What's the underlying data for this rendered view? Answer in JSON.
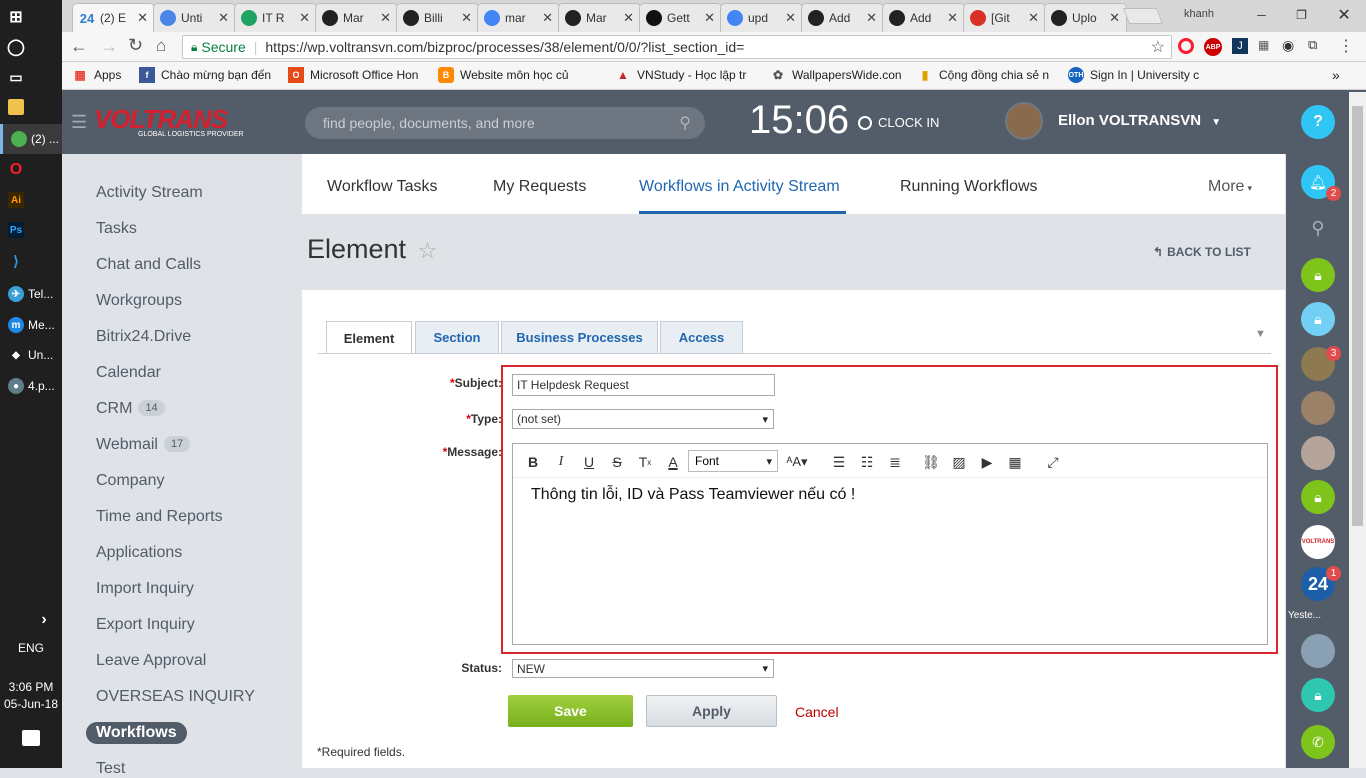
{
  "taskbar": {
    "items": [
      "(2) ...",
      "Tel...",
      "Me...",
      "Un...",
      "4.p..."
    ],
    "lang": "ENG",
    "time": "3:06 PM",
    "date": "05-Jun-18"
  },
  "browser": {
    "tabs": [
      {
        "title": "(2) E",
        "favicon": "24",
        "color": "#2f7dd1"
      },
      {
        "title": "Unti",
        "favicon": "doc-icon",
        "color": "#4a86e8"
      },
      {
        "title": "IT R",
        "favicon": "drive-icon",
        "color": "#1da462"
      },
      {
        "title": "Mar",
        "favicon": "github-icon",
        "color": "#222222"
      },
      {
        "title": "Billi",
        "favicon": "github-icon",
        "color": "#222222"
      },
      {
        "title": "mar",
        "favicon": "google-icon",
        "color": "#4285f4"
      },
      {
        "title": "Mar",
        "favicon": "github-icon",
        "color": "#222222"
      },
      {
        "title": "Gett",
        "favicon": "medium-icon",
        "color": "#111111"
      },
      {
        "title": "upd",
        "favicon": "google-icon",
        "color": "#4285f4"
      },
      {
        "title": "Add",
        "favicon": "github-icon",
        "color": "#222222"
      },
      {
        "title": "Add",
        "favicon": "github-icon",
        "color": "#222222"
      },
      {
        "title": "[Git",
        "favicon": "gmail-icon",
        "color": "#d93025"
      },
      {
        "title": "Uplo",
        "favicon": "github-icon",
        "color": "#222222"
      }
    ],
    "profile": "khanh",
    "secure": "Secure",
    "url": "https://wp.voltransvn.com/bizproc/processes/38/element/0/0/?list_section_id=",
    "bookmarks": [
      "Apps",
      "Chào mừng bạn đến",
      "Microsoft Office Hon",
      "Website môn học củ",
      "VNStudy - Học lập tr",
      "WallpapersWide.con",
      "Cộng đồng chia sẻ n",
      "Sign In | University c"
    ]
  },
  "header": {
    "logo": "VOLTRANS",
    "logo_sub": "GLOBAL LOGISTICS PROVIDER",
    "search_placeholder": "find people, documents, and more",
    "clock": "15:06",
    "clock_in": "CLOCK IN",
    "user": "Ellon VOLTRANSVN"
  },
  "menu": {
    "items": [
      {
        "label": "Activity Stream"
      },
      {
        "label": "Tasks"
      },
      {
        "label": "Chat and Calls"
      },
      {
        "label": "Workgroups"
      },
      {
        "label": "Bitrix24.Drive"
      },
      {
        "label": "Calendar"
      },
      {
        "label": "CRM",
        "count": "14"
      },
      {
        "label": "Webmail",
        "count": "17"
      },
      {
        "label": "Company"
      },
      {
        "label": "Time and Reports"
      },
      {
        "label": "Applications"
      },
      {
        "label": "Import Inquiry"
      },
      {
        "label": "Export Inquiry"
      },
      {
        "label": "Leave Approval"
      },
      {
        "label": "OVERSEAS INQUIRY"
      },
      {
        "label": "Workflows"
      },
      {
        "label": "Test"
      }
    ]
  },
  "topnav": {
    "items": [
      "Workflow Tasks",
      "My Requests",
      "Workflows in Activity Stream",
      "Running Workflows"
    ],
    "more": "More"
  },
  "page": {
    "title": "Element",
    "back": "BACK TO LIST"
  },
  "form": {
    "tabs": [
      "Element",
      "Section",
      "Business Processes",
      "Access"
    ],
    "subject_label": "Subject:",
    "subject_value": "IT Helpdesk Request",
    "type_label": "Type:",
    "type_value": "(not set)",
    "message_label": "Message:",
    "message_text": "Thông tin lỗi, ID và Pass Teamviewer nếu có !",
    "font_select": "Font",
    "status_label": "Status:",
    "status_value": "NEW",
    "save": "Save",
    "apply": "Apply",
    "cancel": "Cancel",
    "required_note": "*Required fields."
  },
  "rightbar": {
    "notif_count": "2",
    "avatar_count": "3",
    "b24_count": "1",
    "yesterday": "Yeste..."
  }
}
